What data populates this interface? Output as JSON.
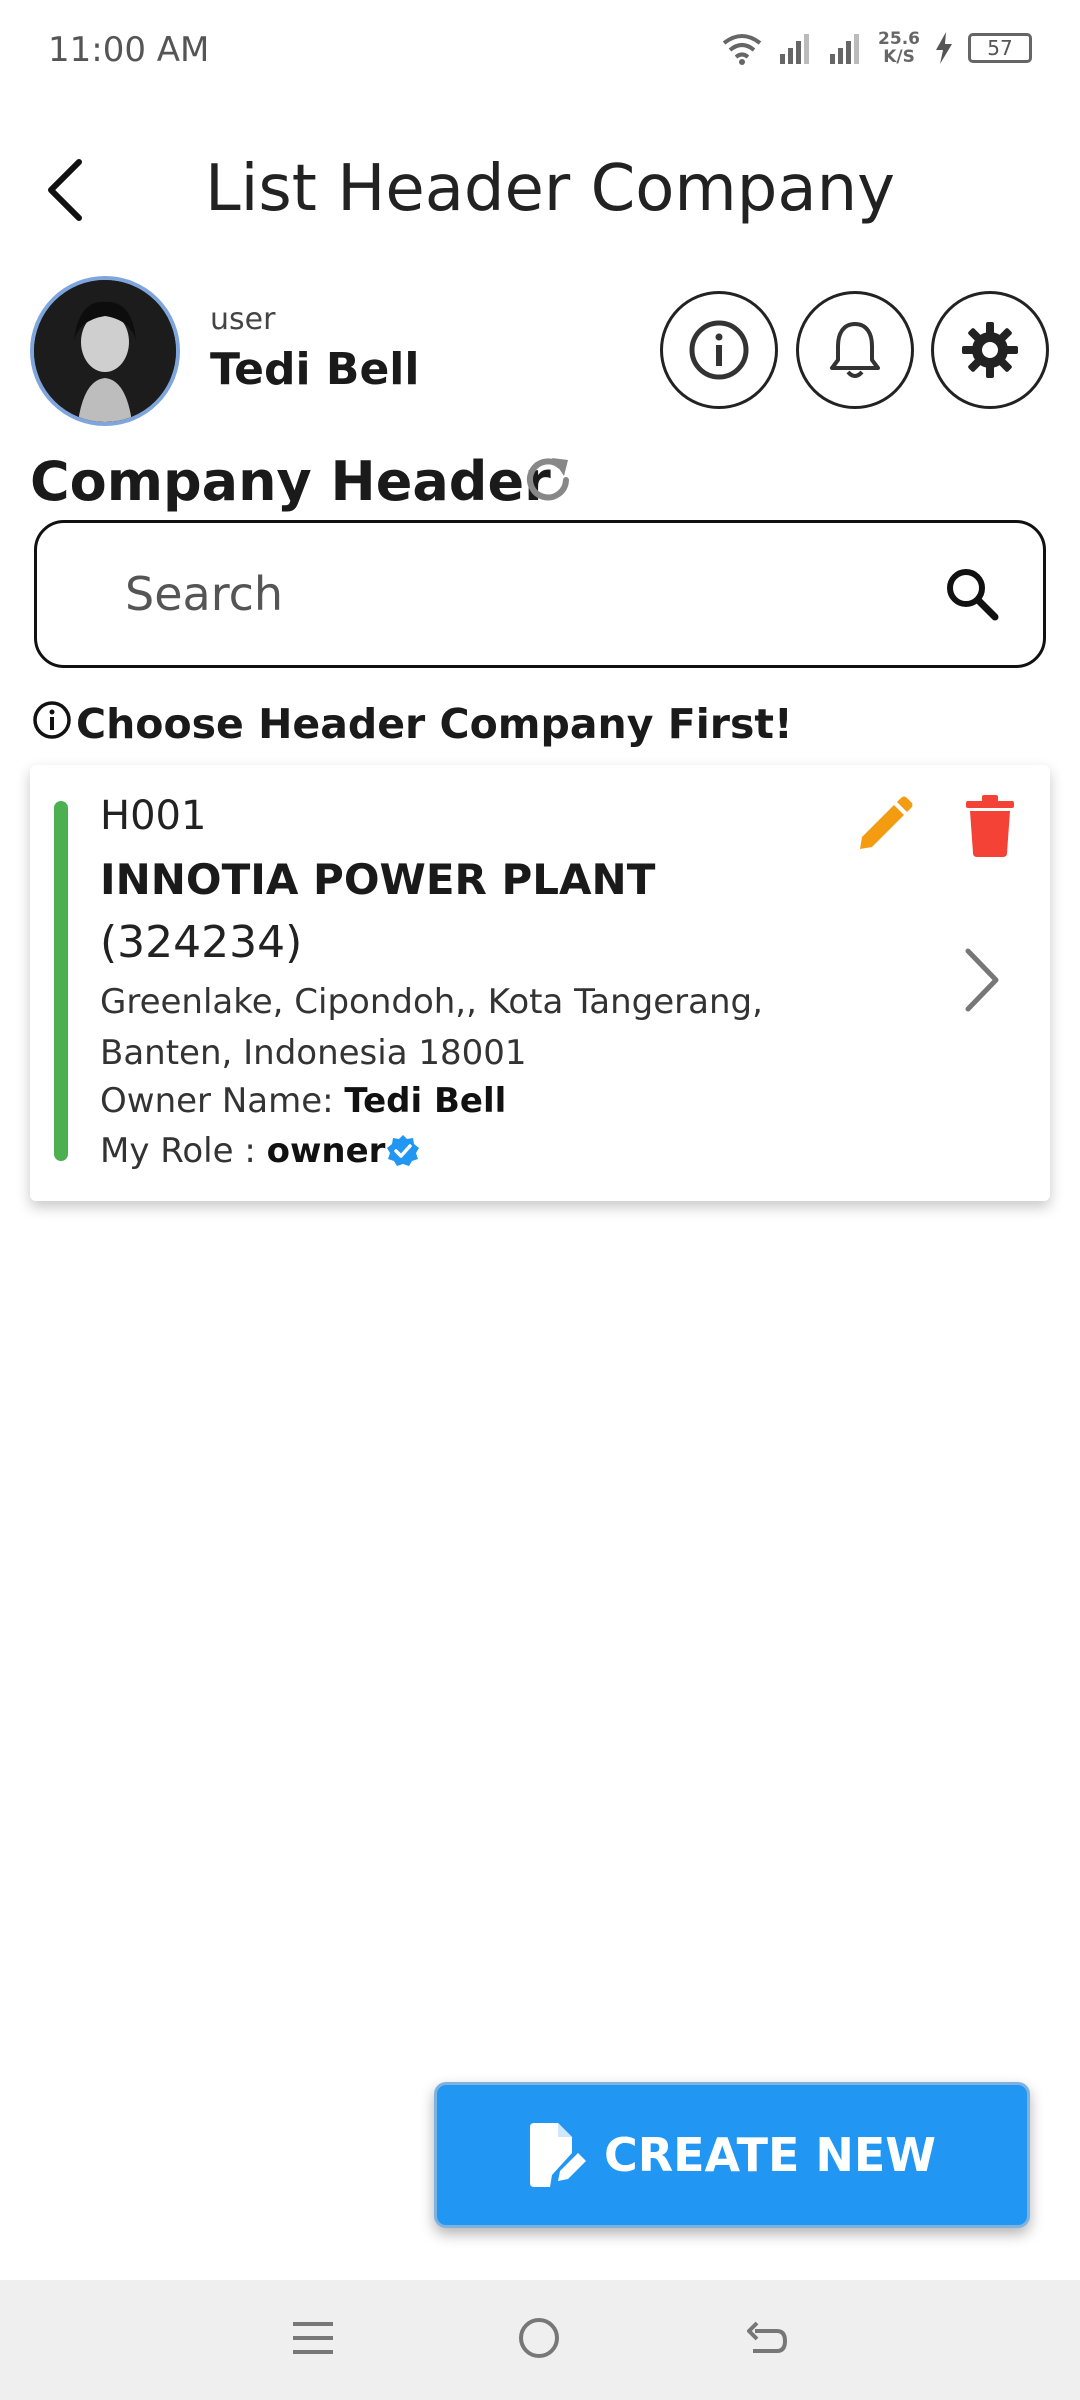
{
  "status_bar": {
    "time": "11:00 AM",
    "speed_value": "25.6",
    "speed_unit": "K/S",
    "battery": "57"
  },
  "header": {
    "title": "List Header Company"
  },
  "user": {
    "role_label": "user",
    "name": "Tedi Bell"
  },
  "section": {
    "title": "Company Header"
  },
  "search": {
    "placeholder": "Search"
  },
  "hint": {
    "text": "Choose Header Company First!"
  },
  "company_card": {
    "code": "H001",
    "name": "INNOTIA POWER PLANT",
    "number": "(324234)",
    "address": "Greenlake, Cipondoh,, Kota Tangerang, Banten, Indonesia 18001",
    "owner_label": "Owner Name: ",
    "owner_name": "Tedi Bell",
    "role_label": "My Role : ",
    "role_value": "owner"
  },
  "create_button": {
    "label": "CREATE NEW"
  },
  "colors": {
    "accent_blue": "#2196f3",
    "card_bar_green": "#4caf50",
    "edit_orange": "#f39c12",
    "delete_red": "#f44336",
    "verified_blue": "#2196f3"
  }
}
